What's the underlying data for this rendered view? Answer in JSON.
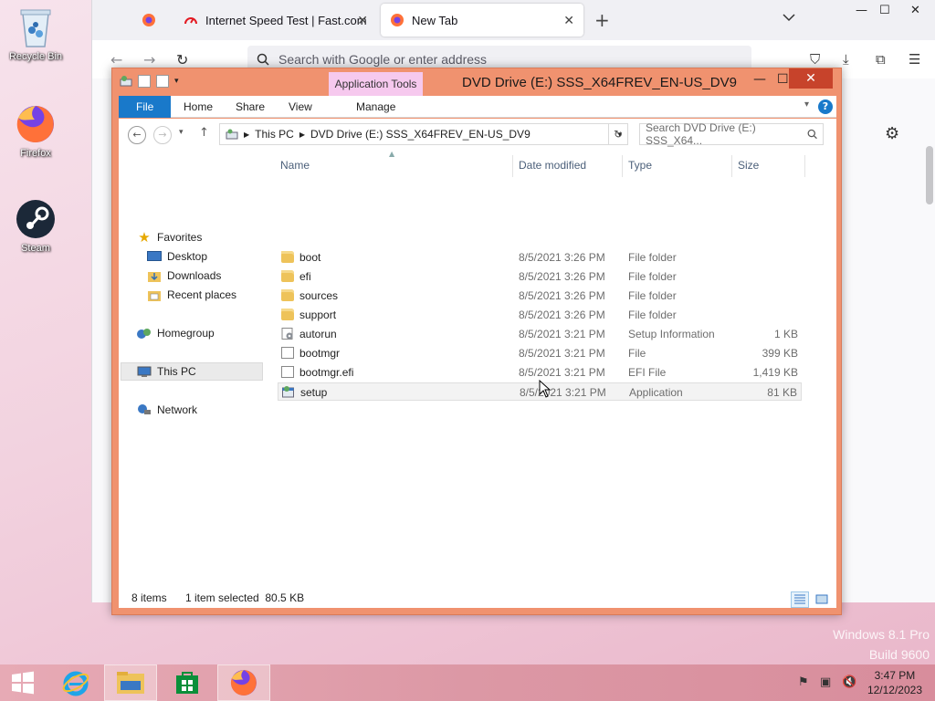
{
  "desktop": {
    "icons": [
      {
        "label": "Recycle Bin"
      },
      {
        "label": "Firefox"
      },
      {
        "label": "Steam"
      }
    ],
    "watermark_line1": "Windows 8.1 Pro",
    "watermark_line2": "Build 9600"
  },
  "browser": {
    "tabs": [
      {
        "label": ""
      },
      {
        "label": "Internet Speed Test | Fast.com"
      },
      {
        "label": "New Tab"
      }
    ],
    "url_placeholder": "Search with Google or enter address",
    "new_tab_symbol": "+"
  },
  "explorer": {
    "title": "DVD Drive (E:) SSS_X64FREV_EN-US_DV9",
    "app_tools_label": "Application Tools",
    "ribbon_tabs": [
      "File",
      "Home",
      "Share",
      "View",
      "Manage"
    ],
    "breadcrumb": [
      "This PC",
      "DVD Drive (E:) SSS_X64FREV_EN-US_DV9"
    ],
    "search_placeholder": "Search DVD Drive (E:) SSS_X64...",
    "nav": {
      "favorites": "Favorites",
      "desktop": "Desktop",
      "downloads": "Downloads",
      "recent": "Recent places",
      "homegroup": "Homegroup",
      "this_pc": "This PC",
      "network": "Network"
    },
    "columns": {
      "name": "Name",
      "date": "Date modified",
      "type": "Type",
      "size": "Size"
    },
    "files": [
      {
        "name": "boot",
        "date": "8/5/2021 3:26 PM",
        "type": "File folder",
        "size": "",
        "kind": "folder"
      },
      {
        "name": "efi",
        "date": "8/5/2021 3:26 PM",
        "type": "File folder",
        "size": "",
        "kind": "folder"
      },
      {
        "name": "sources",
        "date": "8/5/2021 3:26 PM",
        "type": "File folder",
        "size": "",
        "kind": "folder"
      },
      {
        "name": "support",
        "date": "8/5/2021 3:26 PM",
        "type": "File folder",
        "size": "",
        "kind": "folder"
      },
      {
        "name": "autorun",
        "date": "8/5/2021 3:21 PM",
        "type": "Setup Information",
        "size": "1 KB",
        "kind": "inf"
      },
      {
        "name": "bootmgr",
        "date": "8/5/2021 3:21 PM",
        "type": "File",
        "size": "399 KB",
        "kind": "file"
      },
      {
        "name": "bootmgr.efi",
        "date": "8/5/2021 3:21 PM",
        "type": "EFI File",
        "size": "1,419 KB",
        "kind": "file"
      },
      {
        "name": "setup",
        "date": "8/5/2021 3:21 PM",
        "type": "Application",
        "size": "81 KB",
        "kind": "app"
      }
    ],
    "status": {
      "count": "8 items",
      "selection": "1 item selected  80.5 KB"
    }
  },
  "taskbar": {
    "time": "3:47 PM",
    "date": "12/12/2023"
  },
  "colors": {
    "explorer_frame": "#f0926f",
    "file_tab": "#1979ca",
    "app_tools": "#f6c9ee",
    "close_button": "#c7432b"
  }
}
